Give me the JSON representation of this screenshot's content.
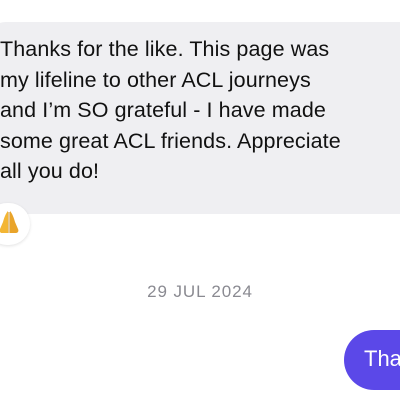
{
  "conversation": {
    "incoming_message": {
      "text": "Thanks for the like. This page was\nmy lifeline to other ACL journeys\nand I’m SO grateful -  I have made\nsome great ACL friends. Appreciate\nall you do!",
      "bubble_color": "#efeff2",
      "reaction": {
        "icon": "folded-hands-icon",
        "emoji": "🙏"
      }
    },
    "date_separator": "29 JUL 2024",
    "outgoing_message": {
      "text": "Thanks",
      "bubble_color": "#5b48e8"
    }
  }
}
